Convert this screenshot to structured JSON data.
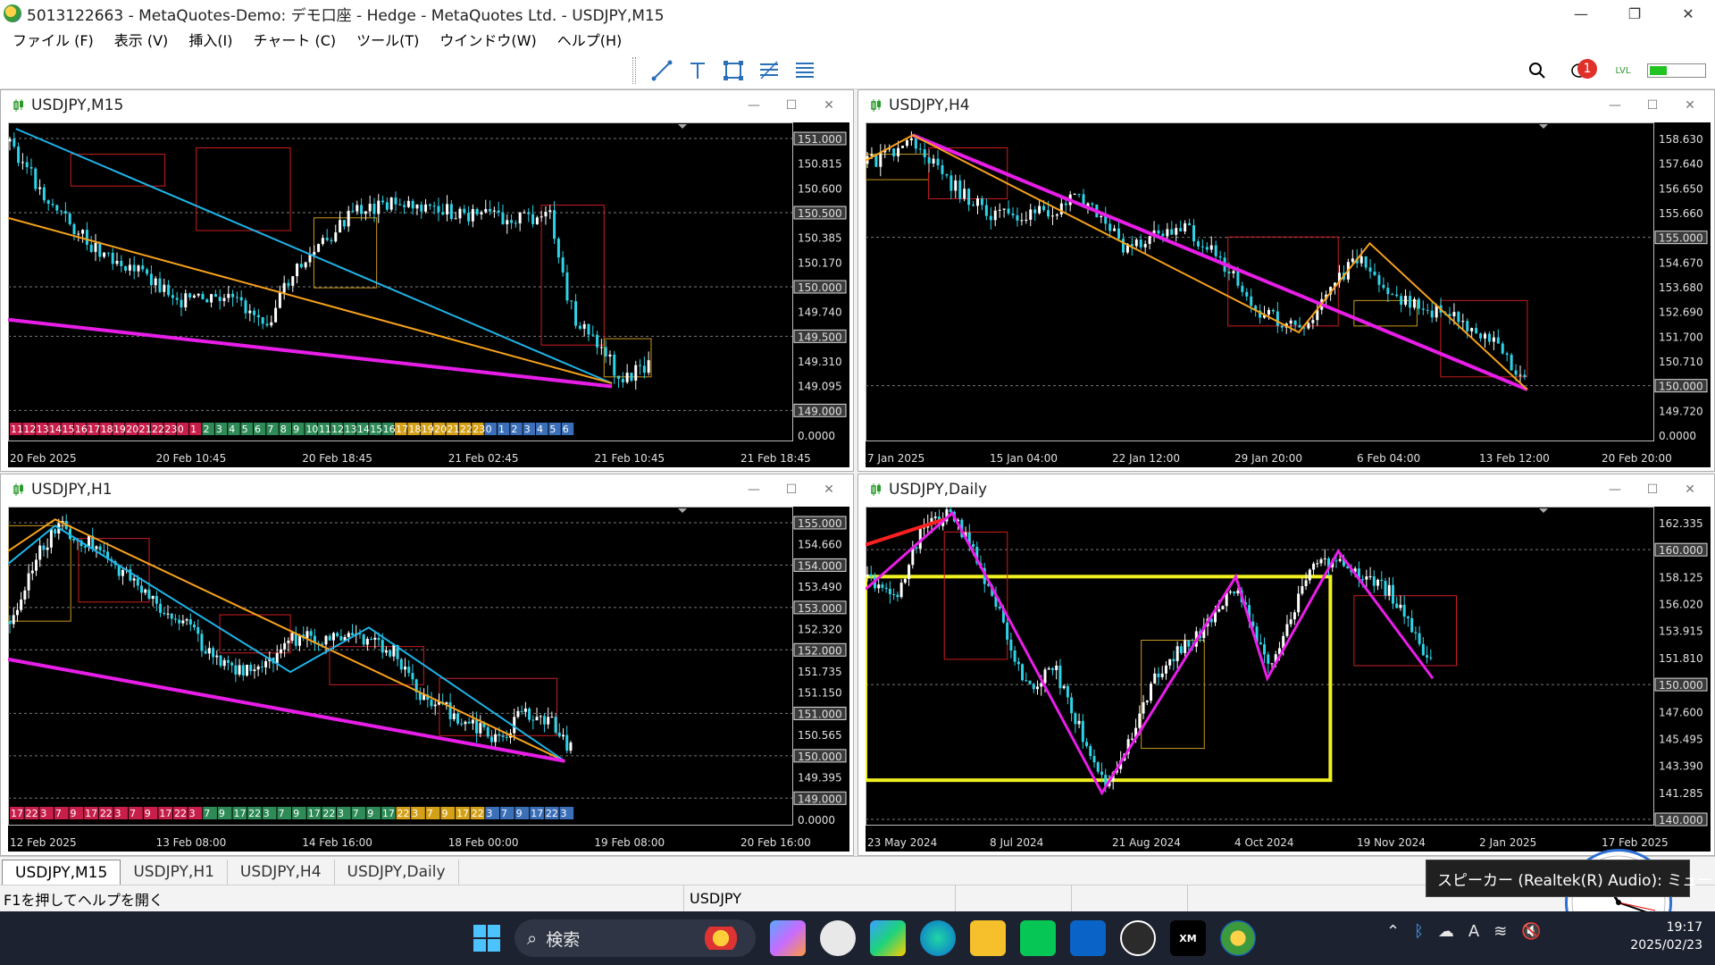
{
  "window": {
    "title": "5013122663 - MetaQuotes-Demo: デモ口座 - Hedge - MetaQuotes Ltd. - USDJPY,M15",
    "minimize": "—",
    "restore": "❐",
    "close": "✕"
  },
  "menu": [
    "ファイル (F)",
    "表示 (V)",
    "挿入(I)",
    "チャート (C)",
    "ツール(T)",
    "ウインドウ(W)",
    "ヘルプ(H)"
  ],
  "toolbar": {
    "tools": [
      "trendline-icon",
      "text-icon",
      "rectangle-icon",
      "fibonacci-icon",
      "channel-icon"
    ],
    "notification_count": "1",
    "signal_label": "LVL",
    "connection_level": 0.3
  },
  "charts": [
    {
      "id": "m15",
      "title": "USDJPY,M15",
      "price_labels": [
        "151.000",
        "150.815",
        "150.600",
        "150.500",
        "150.385",
        "150.170",
        "150.000",
        "149.740",
        "149.500",
        "149.310",
        "149.095",
        "149.000",
        "0.0000"
      ],
      "price_labels_boxed": [
        "151.000",
        "150.500",
        "150.000",
        "149.500",
        "149.000"
      ],
      "time_labels": [
        "20 Feb 2025",
        "20 Feb 10:45",
        "20 Feb 18:45",
        "21 Feb 02:45",
        "21 Feb 10:45",
        "21 Feb 18:45"
      ],
      "hour_strip": [
        "11",
        "12",
        "13",
        "14",
        "15",
        "16",
        "17",
        "18",
        "19",
        "20",
        "21",
        "22",
        "23",
        "0",
        "1",
        "2",
        "3",
        "4",
        "5",
        "6",
        "7",
        "8",
        "9",
        "10",
        "11",
        "12",
        "13",
        "14",
        "15",
        "16",
        "17",
        "18",
        "19",
        "20",
        "21",
        "22",
        "23",
        "0",
        "1",
        "2",
        "3",
        "4",
        "5",
        "6"
      ]
    },
    {
      "id": "h4",
      "title": "USDJPY,H4",
      "price_labels": [
        "158.630",
        "157.640",
        "156.650",
        "155.660",
        "155.000",
        "154.670",
        "153.680",
        "152.690",
        "151.700",
        "150.710",
        "150.000",
        "149.720",
        "0.0000"
      ],
      "price_labels_boxed": [
        "155.000",
        "150.000"
      ],
      "time_labels": [
        "7 Jan 2025",
        "15 Jan 04:00",
        "22 Jan 12:00",
        "29 Jan 20:00",
        "6 Feb 04:00",
        "13 Feb 12:00",
        "20 Feb 20:00"
      ]
    },
    {
      "id": "h1",
      "title": "USDJPY,H1",
      "price_labels": [
        "155.000",
        "154.660",
        "154.000",
        "153.490",
        "153.000",
        "152.320",
        "152.000",
        "151.735",
        "151.150",
        "151.000",
        "150.565",
        "150.000",
        "149.395",
        "149.000",
        "0.0000"
      ],
      "price_labels_boxed": [
        "155.000",
        "154.000",
        "153.000",
        "152.000",
        "151.000",
        "150.000",
        "149.000"
      ],
      "time_labels": [
        "12 Feb 2025",
        "13 Feb 08:00",
        "14 Feb 16:00",
        "18 Feb 00:00",
        "19 Feb 08:00",
        "20 Feb 16:00"
      ],
      "hour_strip": [
        "17",
        "22",
        "3",
        "7",
        "9",
        "17",
        "22",
        "3",
        "7",
        "9",
        "17",
        "22",
        "3",
        "7",
        "9",
        "17",
        "22",
        "3",
        "7",
        "9",
        "17",
        "22",
        "3",
        "7",
        "9",
        "17",
        "22",
        "3",
        "7",
        "9",
        "17",
        "22",
        "3",
        "7",
        "9",
        "17",
        "22",
        "3"
      ]
    },
    {
      "id": "daily",
      "title": "USDJPY,Daily",
      "price_labels": [
        "162.335",
        "160.000",
        "158.125",
        "156.020",
        "153.915",
        "151.810",
        "150.000",
        "147.600",
        "145.495",
        "143.390",
        "141.285",
        "140.000"
      ],
      "price_labels_boxed": [
        "160.000",
        "150.000",
        "140.000"
      ],
      "time_labels": [
        "23 May 2024",
        "8 Jul 2024",
        "21 Aug 2024",
        "4 Oct 2024",
        "19 Nov 2024",
        "2 Jan 2025",
        "17 Feb 2025"
      ]
    }
  ],
  "tabs": [
    "USDJPY,M15",
    "USDJPY,H1",
    "USDJPY,H4",
    "USDJPY,Daily"
  ],
  "active_tab": "USDJPY,M15",
  "status": {
    "help": "F1を押してヘルプを開く",
    "symbol": "USDJPY"
  },
  "tooltip": "スピーカー (Realtek(R) Audio): ミュート",
  "taskbar": {
    "search_placeholder": "検索",
    "time": "19:17",
    "date": "2025/02/23",
    "apps": [
      "copilot-icon",
      "clock-app-icon",
      "store-icon",
      "edge-icon",
      "explorer-icon",
      "line-icon",
      "outlook-icon",
      "vpn-icon",
      "xm-icon",
      "mt5-icon"
    ],
    "xm_label": "XM"
  },
  "colors": {
    "chart_bg": "#000000",
    "candle_up": "#ffffff",
    "candle_down": "#2fd3e8",
    "line_orange": "#f7a21b",
    "line_magenta": "#e81ee8",
    "line_cyan": "#1eb4e8",
    "line_red": "#ff2020",
    "box_yellow": "#f0f020",
    "box_red": "#c81e1e",
    "box_gold": "#c89a1e"
  }
}
